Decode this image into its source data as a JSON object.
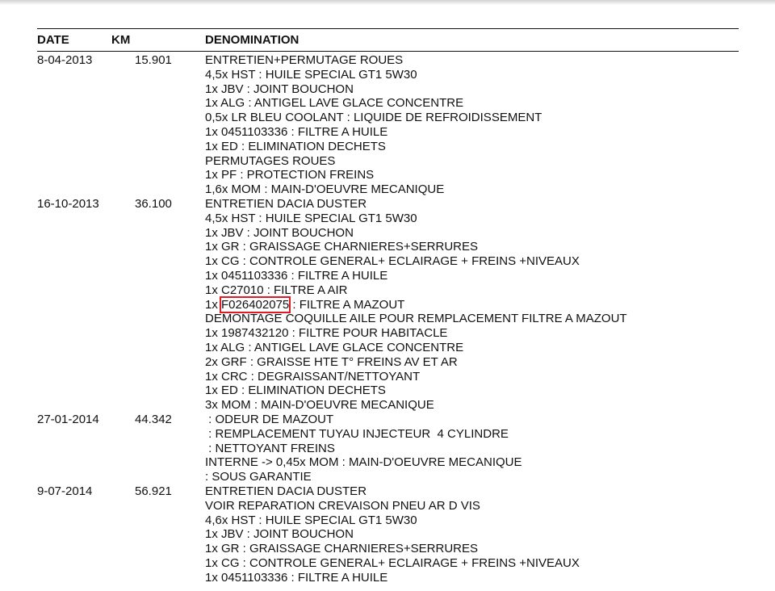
{
  "header": {
    "date": "DATE",
    "km": "KM",
    "denomination": "DENOMINATION"
  },
  "records": [
    {
      "date": "8-04-2013",
      "km": "15.901",
      "lines": [
        "ENTRETIEN+PERMUTAGE ROUES",
        "4,5x HST : HUILE SPECIAL GT1 5W30",
        "1x JBV : JOINT BOUCHON",
        "1x ALG : ANTIGEL LAVE GLACE CONCENTRE",
        "0,5x LR BLEU COOLANT : LIQUIDE DE REFROIDISSEMENT",
        "1x 0451103336 : FILTRE A HUILE",
        "1x ED : ELIMINATION DECHETS",
        "PERMUTAGES ROUES",
        "1x PF : PROTECTION FREINS",
        "1,6x MOM : MAIN-D'OEUVRE MECANIQUE"
      ]
    },
    {
      "date": "16-10-2013",
      "km": "36.100",
      "lines": [
        "ENTRETIEN DACIA DUSTER",
        "4,5x HST : HUILE SPECIAL GT1 5W30",
        "1x JBV : JOINT BOUCHON",
        "1x GR : GRAISSAGE CHARNIERES+SERRURES",
        "1x CG : CONTROLE GENERAL+ ECLAIRAGE + FREINS +NIVEAUX",
        "1x 0451103336 : FILTRE A HUILE",
        "1x C27010 : FILTRE A AIR",
        {
          "prefix": "1x ",
          "highlight": "F026402075",
          "suffix": " : FILTRE A MAZOUT"
        },
        "DEMONTAGE COQUILLE AILE POUR REMPLACEMENT FILTRE A MAZOUT",
        "1x 1987432120 : FILTRE POUR HABITACLE",
        "1x ALG : ANTIGEL LAVE GLACE CONCENTRE",
        "2x GRF : GRAISSE HTE T° FREINS AV ET AR",
        "1x CRC : DEGRAISSANT/NETTOYANT",
        "1x ED : ELIMINATION DECHETS",
        "3x MOM : MAIN-D'OEUVRE MECANIQUE"
      ]
    },
    {
      "date": "27-01-2014",
      "km": "44.342",
      "lines": [
        " : ODEUR DE MAZOUT",
        " : REMPLACEMENT TUYAU INJECTEUR  4 CYLINDRE",
        " : NETTOYANT FREINS",
        "INTERNE -> 0,45x MOM : MAIN-D'OEUVRE MECANIQUE",
        ": SOUS GARANTIE"
      ]
    },
    {
      "date": "9-07-2014",
      "km": "56.921",
      "lines": [
        "ENTRETIEN DACIA DUSTER",
        "VOIR REPARATION CREVAISON PNEU AR D VIS",
        "4,6x HST : HUILE SPECIAL GT1 5W30",
        "1x JBV : JOINT BOUCHON",
        "1x GR : GRAISSAGE CHARNIERES+SERRURES",
        "1x CG : CONTROLE GENERAL+ ECLAIRAGE + FREINS +NIVEAUX",
        "1x 0451103336 : FILTRE A HUILE"
      ]
    }
  ],
  "colors": {
    "text": "#111111",
    "highlight_box": "#e01b24"
  }
}
